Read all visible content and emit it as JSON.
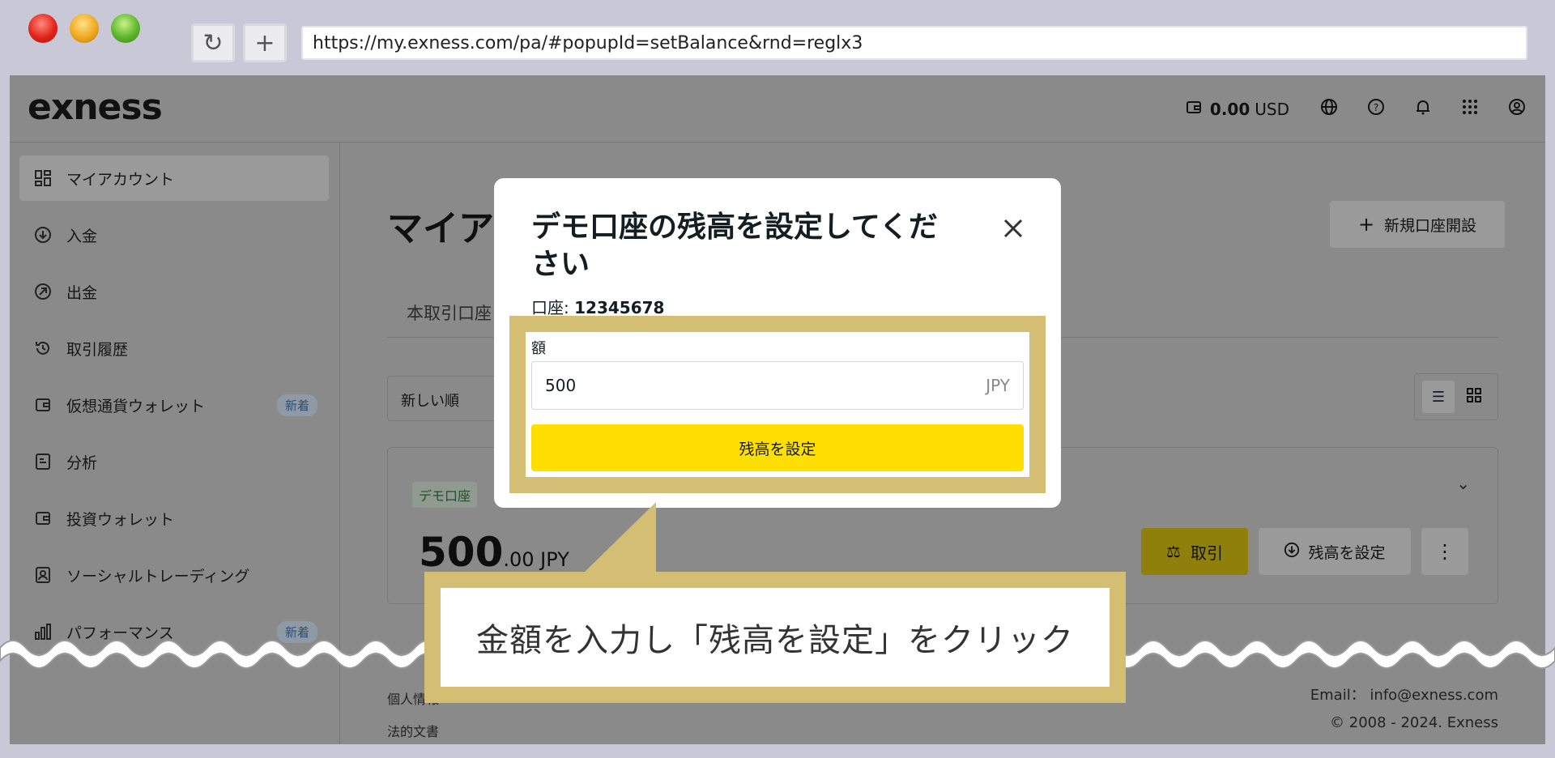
{
  "browser": {
    "url": "https://my.exness.com/pa/#popupId=setBalance&rnd=reglx3",
    "reload_icon": "reload-icon",
    "newtab_icon": "plus-icon"
  },
  "header": {
    "logo": "exness",
    "balance_amount": "0.00",
    "balance_currency": "USD",
    "icons": [
      "wallet-icon",
      "globe-icon",
      "help-icon",
      "bell-icon",
      "apps-grid-icon",
      "user-icon"
    ]
  },
  "sidebar": {
    "items": [
      {
        "label": "マイアカウント",
        "icon": "dashboard-icon",
        "active": true
      },
      {
        "label": "入金",
        "icon": "deposit-icon"
      },
      {
        "label": "出金",
        "icon": "withdraw-icon"
      },
      {
        "label": "取引履歴",
        "icon": "history-icon"
      },
      {
        "label": "仮想通貨ウォレット",
        "icon": "wallet-icon",
        "badge": "新着"
      },
      {
        "label": "分析",
        "icon": "analytics-icon"
      },
      {
        "label": "投資ウォレット",
        "icon": "wallet-icon"
      },
      {
        "label": "ソーシャルトレーディング",
        "icon": "social-icon"
      },
      {
        "label": "パフォーマンス",
        "icon": "bar-chart-icon",
        "badge": "新着"
      }
    ]
  },
  "main": {
    "title": "マイアカウント",
    "new_account_label": "新規口座開設",
    "tab_real": "本取引口座",
    "sort_label": "新しい順",
    "card": {
      "tag": "デモ口座",
      "balance_int": "500",
      "balance_dec": ".00 JPY",
      "trade_label": "取引",
      "set_balance_label": "残高を設定"
    },
    "footer_left": [
      "個人情報",
      "法的文書"
    ],
    "footer_email": "Email： info@exness.com",
    "footer_copyright": "© 2008 - 2024. Exness"
  },
  "modal": {
    "title": "デモ口座の残高を設定してください",
    "account_label": "口座:",
    "account_number": "12345678",
    "amount_label": "額",
    "amount_value": "500",
    "amount_currency": "JPY",
    "submit_label": "残高を設定"
  },
  "callout": {
    "text": "金額を入力し「残高を設定」をクリック"
  },
  "colors": {
    "accent_yellow": "#ffde02",
    "highlight_gold": "#d4be74",
    "overlay_gray": "#8a8a8a"
  }
}
